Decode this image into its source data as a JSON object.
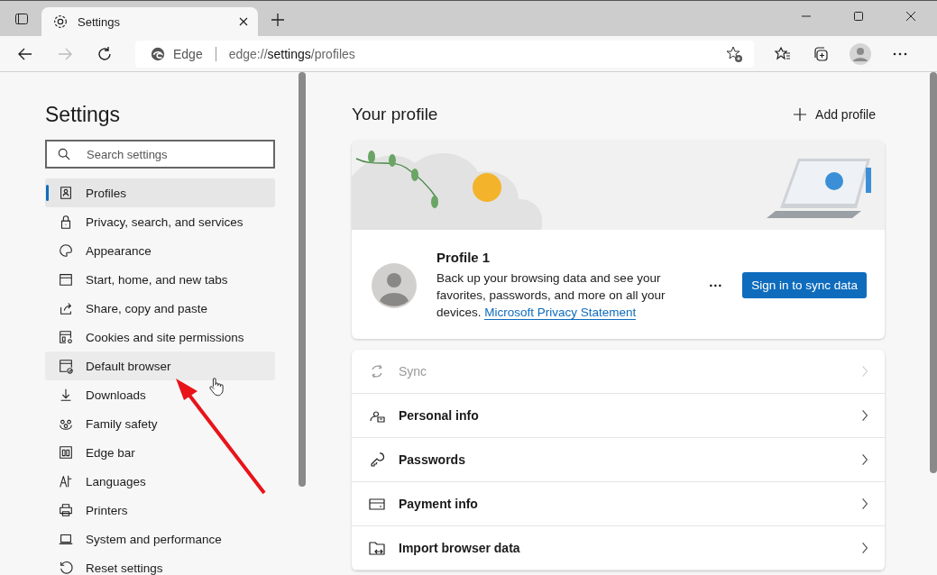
{
  "tab": {
    "title": "Settings",
    "selected": true
  },
  "address_bar": {
    "site_label": "Edge",
    "url": "edge://**settings**/profiles"
  },
  "sidebar": {
    "title": "Settings",
    "search": {
      "placeholder": "Search settings"
    },
    "items": [
      {
        "label": "Profiles",
        "selected": true,
        "hovered": false
      },
      {
        "label": "Privacy, search, and services",
        "selected": false,
        "hovered": false
      },
      {
        "label": "Appearance",
        "selected": false,
        "hovered": false
      },
      {
        "label": "Start, home, and new tabs",
        "selected": false,
        "hovered": false
      },
      {
        "label": "Share, copy and paste",
        "selected": false,
        "hovered": false
      },
      {
        "label": "Cookies and site permissions",
        "selected": false,
        "hovered": false
      },
      {
        "label": "Default browser",
        "selected": false,
        "hovered": true
      },
      {
        "label": "Downloads",
        "selected": false,
        "hovered": false
      },
      {
        "label": "Family safety",
        "selected": false,
        "hovered": false
      },
      {
        "label": "Edge bar",
        "selected": false,
        "hovered": false
      },
      {
        "label": "Languages",
        "selected": false,
        "hovered": false
      },
      {
        "label": "Printers",
        "selected": false,
        "hovered": false
      },
      {
        "label": "System and performance",
        "selected": false,
        "hovered": false
      },
      {
        "label": "Reset settings",
        "selected": false,
        "hovered": false
      }
    ]
  },
  "main": {
    "title": "Your profile",
    "add_profile": "Add profile",
    "profile": {
      "name": "Profile 1",
      "description": "Back up your browsing data and see your favorites, passwords, and more on all your devices.",
      "link": "Microsoft Privacy Statement",
      "more": "···",
      "sign_in": "Sign in to sync data"
    },
    "rows": [
      {
        "label": "Sync",
        "disabled": true
      },
      {
        "label": "Personal info",
        "disabled": false
      },
      {
        "label": "Passwords",
        "disabled": false
      },
      {
        "label": "Payment info",
        "disabled": false
      },
      {
        "label": "Import browser data",
        "disabled": false
      }
    ]
  }
}
